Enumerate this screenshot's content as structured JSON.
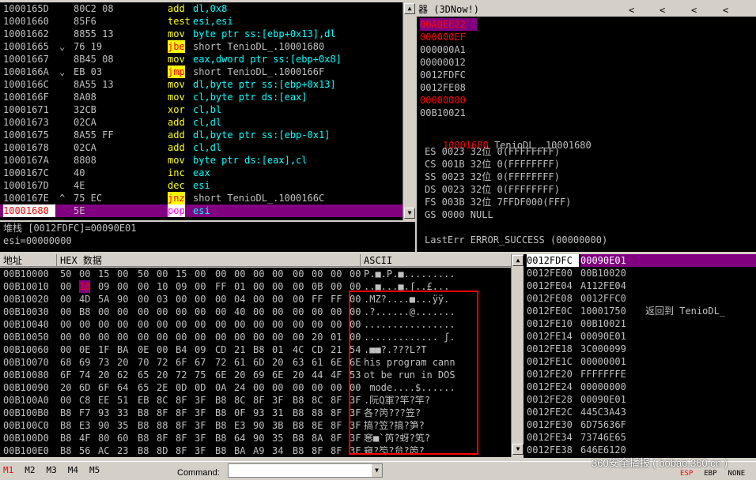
{
  "disasm": {
    "rows": [
      {
        "addr": "1000165D",
        "mark": "",
        "bytes": "80C2 08",
        "mn": "add",
        "args": "dl,0x8",
        "jmp": false
      },
      {
        "addr": "10001660",
        "mark": "",
        "bytes": "85F6",
        "mn": "test",
        "args": "esi,esi",
        "jmp": false
      },
      {
        "addr": "10001662",
        "mark": "",
        "bytes": "8855 13",
        "mn": "mov",
        "args": "byte ptr ss:[ebp+0x13],dl",
        "jmp": false
      },
      {
        "addr": "10001665",
        "mark": "⌄",
        "bytes": "76 19",
        "mn": "jbe",
        "args": "short TenioDL_.10001680",
        "jmp": true
      },
      {
        "addr": "10001667",
        "mark": "",
        "bytes": "8B45 08",
        "mn": "mov",
        "args": "eax,dword ptr ss:[ebp+0x8]",
        "jmp": false
      },
      {
        "addr": "1000166A",
        "mark": "⌄",
        "bytes": "EB 03",
        "mn": "jmp",
        "args": "short TenioDL_.1000166F",
        "jmp": true
      },
      {
        "addr": "1000166C",
        "mark": "",
        "bytes": "8A55 13",
        "mn": "mov",
        "args": "dl,byte ptr ss:[ebp+0x13]",
        "jmp": false
      },
      {
        "addr": "1000166F",
        "mark": "",
        "bytes": "8A08",
        "mn": "mov",
        "args": "cl,byte ptr ds:[eax]",
        "jmp": false
      },
      {
        "addr": "10001671",
        "mark": "",
        "bytes": "32CB",
        "mn": "xor",
        "args": "cl,bl",
        "jmp": false
      },
      {
        "addr": "10001673",
        "mark": "",
        "bytes": "02CA",
        "mn": "add",
        "args": "cl,dl",
        "jmp": false
      },
      {
        "addr": "10001675",
        "mark": "",
        "bytes": "8A55 FF",
        "mn": "add",
        "args": "dl,byte ptr ss:[ebp-0x1]",
        "jmp": false
      },
      {
        "addr": "10001678",
        "mark": "",
        "bytes": "02CA",
        "mn": "add",
        "args": "cl,dl",
        "jmp": false
      },
      {
        "addr": "1000167A",
        "mark": "",
        "bytes": "8808",
        "mn": "mov",
        "args": "byte ptr ds:[eax],cl",
        "jmp": false
      },
      {
        "addr": "1000167C",
        "mark": "",
        "bytes": "40",
        "mn": "inc",
        "args": "eax",
        "jmp": false
      },
      {
        "addr": "1000167D",
        "mark": "",
        "bytes": "4E",
        "mn": "dec",
        "args": "esi",
        "jmp": false
      },
      {
        "addr": "1000167E",
        "mark": "^",
        "bytes": "75 EC",
        "mn": "jnz",
        "args": "short TenioDL_.1000166C",
        "jmp": true
      },
      {
        "addr": "10001680",
        "mark": "",
        "bytes": "5E",
        "mn": "pop",
        "args": "esi",
        "jmp": false,
        "current": true
      }
    ]
  },
  "info": {
    "line1": "堆栈 [0012FDFC]=00090E01",
    "line2": "esi=00000000"
  },
  "regs": {
    "title": "器 (3DNow!)",
    "nav": [
      "<",
      "<",
      "<",
      "<"
    ],
    "vals": [
      {
        "v": "00A0EE22",
        "hl": true
      },
      {
        "v": "000000EF",
        "red": true
      },
      {
        "v": "000000A1"
      },
      {
        "v": "00000012"
      },
      {
        "v": "0012FDFC"
      },
      {
        "v": "0012FE08"
      },
      {
        "v": "00000000",
        "red": true
      },
      {
        "v": "00B10021"
      }
    ],
    "eip_addr": "10001680",
    "eip_label": "TenioDL_.10001680",
    "segs": [
      {
        "n": "ES",
        "s": "0023",
        "b": "32位",
        "r": "0(FFFFFFFF)"
      },
      {
        "n": "CS",
        "s": "001B",
        "b": "32位",
        "r": "0(FFFFFFFF)"
      },
      {
        "n": "SS",
        "s": "0023",
        "b": "32位",
        "r": "0(FFFFFFFF)"
      },
      {
        "n": "DS",
        "s": "0023",
        "b": "32位",
        "r": "0(FFFFFFFF)"
      },
      {
        "n": "FS",
        "s": "003B",
        "b": "32位",
        "r": "7FFDF000(FFF)"
      },
      {
        "n": "GS",
        "s": "0000",
        "b": "NULL",
        "r": ""
      }
    ],
    "lasterr": "LastErr ERROR_SUCCESS (00000000)"
  },
  "dump": {
    "h_addr": "地址",
    "h_hex": "HEX 数据",
    "h_ascii": "ASCII",
    "rows": [
      {
        "a": "00B10000",
        "h": [
          "50",
          "00",
          "15",
          "00",
          "50",
          "00",
          "15",
          "00",
          "00",
          "00",
          "00",
          "00",
          "00",
          "00",
          "00",
          "00"
        ],
        "s": "P.■.P.■........."
      },
      {
        "a": "00B10010",
        "h": [
          "00",
          "10",
          "09",
          "00",
          "00",
          "10",
          "09",
          "00",
          "FF",
          "01",
          "00",
          "00",
          "00",
          "0B",
          "00",
          "00"
        ],
        "s": "..■...■.ʃ..£..."
      },
      {
        "a": "00B10020",
        "h": [
          "00",
          "4D",
          "5A",
          "90",
          "00",
          "03",
          "00",
          "00",
          "00",
          "04",
          "00",
          "00",
          "00",
          "FF",
          "FF",
          "00"
        ],
        "s": ".MZ?....■...ÿÿ."
      },
      {
        "a": "00B10030",
        "h": [
          "00",
          "B8",
          "00",
          "00",
          "00",
          "00",
          "00",
          "00",
          "00",
          "40",
          "00",
          "00",
          "00",
          "00",
          "00",
          "00"
        ],
        "s": ".?......@......."
      },
      {
        "a": "00B10040",
        "h": [
          "00",
          "00",
          "00",
          "00",
          "00",
          "00",
          "00",
          "00",
          "00",
          "00",
          "00",
          "00",
          "00",
          "00",
          "00",
          "00"
        ],
        "s": "................"
      },
      {
        "a": "00B10050",
        "h": [
          "00",
          "00",
          "00",
          "00",
          "00",
          "00",
          "00",
          "00",
          "00",
          "00",
          "00",
          "00",
          "00",
          "20",
          "01",
          "00"
        ],
        "s": "............. ʃ."
      },
      {
        "a": "00B10060",
        "h": [
          "00",
          "0E",
          "1F",
          "BA",
          "0E",
          "00",
          "B4",
          "09",
          "CD",
          "21",
          "B8",
          "01",
          "4C",
          "CD",
          "21",
          "54"
        ],
        "s": ".■■?.???L?T"
      },
      {
        "a": "00B10070",
        "h": [
          "68",
          "69",
          "73",
          "20",
          "70",
          "72",
          "6F",
          "67",
          "72",
          "61",
          "6D",
          "20",
          "63",
          "61",
          "6E",
          "6E"
        ],
        "s": "his program cann"
      },
      {
        "a": "00B10080",
        "h": [
          "6F",
          "74",
          "20",
          "62",
          "65",
          "20",
          "72",
          "75",
          "6E",
          "20",
          "69",
          "6E",
          "20",
          "44",
          "4F",
          "53"
        ],
        "s": "ot be run in DOS"
      },
      {
        "a": "00B10090",
        "h": [
          "20",
          "6D",
          "6F",
          "64",
          "65",
          "2E",
          "0D",
          "0D",
          "0A",
          "24",
          "00",
          "00",
          "00",
          "00",
          "00",
          "00"
        ],
        "s": " mode....$......"
      },
      {
        "a": "00B100A0",
        "h": [
          "00",
          "C8",
          "EE",
          "51",
          "EB",
          "8C",
          "8F",
          "3F",
          "B8",
          "8C",
          "8F",
          "3F",
          "B8",
          "8C",
          "8F",
          "3F"
        ],
        "s": ".阮Q軍?竿?竿?"
      },
      {
        "a": "00B100B0",
        "h": [
          "B8",
          "F7",
          "93",
          "33",
          "B8",
          "8F",
          "8F",
          "3F",
          "B8",
          "0F",
          "93",
          "31",
          "B8",
          "88",
          "8F",
          "3F"
        ],
        "s": "各?笍???笠?"
      },
      {
        "a": "00B100C0",
        "h": [
          "B8",
          "E3",
          "90",
          "35",
          "B8",
          "88",
          "8F",
          "3F",
          "B8",
          "E3",
          "90",
          "3B",
          "B8",
          "8E",
          "8F",
          "3F"
        ],
        "s": "搞?笠?搞?笋?"
      },
      {
        "a": "00B100D0",
        "h": [
          "B8",
          "4F",
          "80",
          "60",
          "B8",
          "8F",
          "8F",
          "3F",
          "B8",
          "64",
          "90",
          "35",
          "B8",
          "8A",
          "8F",
          "3F"
        ],
        "s": "窸■`笍?蚜?笂?"
      },
      {
        "a": "00B100E0",
        "h": [
          "B8",
          "56",
          "AC",
          "23",
          "B8",
          "8D",
          "8F",
          "3F",
          "B8",
          "BA",
          "A9",
          "34",
          "B8",
          "8F",
          "8F",
          "3F"
        ],
        "s": "窺?笉?贠?笍?"
      }
    ]
  },
  "stack": {
    "rows": [
      {
        "a": "0012FDFC",
        "v": "00090E01",
        "c": "",
        "cur": true
      },
      {
        "a": "0012FE00",
        "v": "00B10020",
        "c": ""
      },
      {
        "a": "0012FE04",
        "v": "A112FE04",
        "c": ""
      },
      {
        "a": "0012FE08",
        "v": "0012FFC0",
        "c": ""
      },
      {
        "a": "0012FE0C",
        "v": "10001750",
        "c": "返回到 TenioDL_"
      },
      {
        "a": "0012FE10",
        "v": "00B10021",
        "c": ""
      },
      {
        "a": "0012FE14",
        "v": "00090E01",
        "c": ""
      },
      {
        "a": "0012FE18",
        "v": "3C000099",
        "c": ""
      },
      {
        "a": "0012FE1C",
        "v": "00000001",
        "c": ""
      },
      {
        "a": "0012FE20",
        "v": "FFFFFFFE",
        "c": ""
      },
      {
        "a": "0012FE24",
        "v": "00000000",
        "c": ""
      },
      {
        "a": "0012FE28",
        "v": "00090E01",
        "c": ""
      },
      {
        "a": "0012FE2C",
        "v": "445C3A43",
        "c": ""
      },
      {
        "a": "0012FE30",
        "v": "6D75636F",
        "c": ""
      },
      {
        "a": "0012FE34",
        "v": "73746E65",
        "c": ""
      },
      {
        "a": "0012FE38",
        "v": "646E6120",
        "c": ""
      }
    ]
  },
  "bottom": {
    "tabs": [
      "M1",
      "M2",
      "M3",
      "M4",
      "M5"
    ],
    "command_label": "Command:",
    "flags": [
      "ESP",
      "EBP",
      "NONE"
    ],
    "watermark": "360安全播报 ( bobao.360.cn )"
  },
  "colors": {
    "bg": "#000000",
    "panel": "#d4d0c8",
    "highlight": "#800080",
    "red": "#ff0000",
    "box": "#ff0000"
  }
}
